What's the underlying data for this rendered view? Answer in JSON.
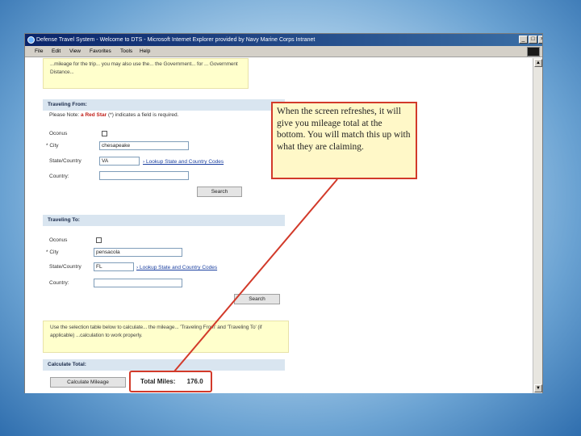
{
  "window": {
    "title": "Defense Travel System - Welcome to DTS - Microsoft Internet Explorer provided by Navy Marine Corps Intranet",
    "controls": {
      "minimize": "_",
      "maximize": "□",
      "close": "×"
    }
  },
  "menu": {
    "items": [
      "File",
      "Edit",
      "View",
      "Favorites",
      "Tools",
      "Help"
    ]
  },
  "page": {
    "intro_text": "...mileage for the trip... you may also use the... the Government... for ... Government Distance...",
    "from": {
      "header": "Traveling From:",
      "note_prefix": "Please Note: ",
      "note_star": "a Red Star",
      "note_suffix": " (*) indicates a field is required.",
      "oconus_label": "Oconus",
      "city_label": "* City",
      "city_value": "chesapeake",
      "state_label": "State/Country",
      "state_value": "VA",
      "lookup_link": "Lookup State and Country Codes",
      "country_label": "Country:",
      "country_value": "",
      "search_button": "Search"
    },
    "to": {
      "header": "Traveling To:",
      "oconus_label": "Oconus",
      "city_label": "* City",
      "city_value": "pensacola",
      "state_label": "State/Country",
      "state_value": "FL",
      "lookup_link": "Lookup State and Country Codes",
      "country_label": "Country:",
      "country_value": "",
      "search_button": "Search"
    },
    "instructions_text": "Use the selection table below to calculate... the mileage... 'Traveling From' and 'Traveling To' (if applicable) ...calculation to work properly.",
    "calculate": {
      "header": "Calculate Total:",
      "button": "Calculate Mileage",
      "total_label": "Total Miles:",
      "total_value": "176.0"
    }
  },
  "callout": {
    "text": "When the screen refreshes, it will give you mileage total at the bottom.  You will match this up with what they are claiming."
  },
  "colors": {
    "callout_border": "#d23a2a",
    "callout_fill": "#fff8c8",
    "titlebar": "#0a246a",
    "section_header": "#d9e5f0"
  }
}
